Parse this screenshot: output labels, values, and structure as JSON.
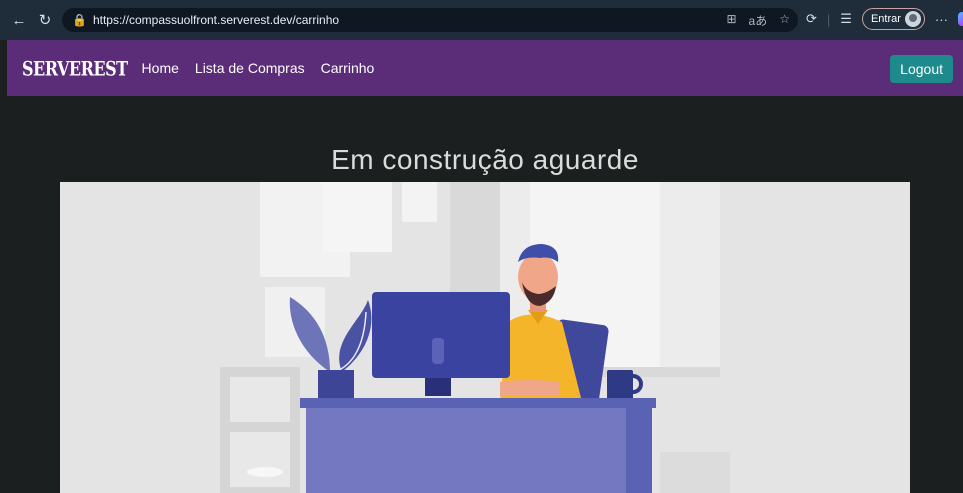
{
  "browser": {
    "url": "https://compassuolfront.serverest.dev/carrinho",
    "signin_label": "Entrar",
    "more_label": "···"
  },
  "navbar": {
    "brand": "SERVEREST",
    "links": [
      "Home",
      "Lista de Compras",
      "Carrinho"
    ],
    "logout_label": "Logout"
  },
  "main": {
    "title": "Em construção aguarde"
  },
  "colors": {
    "navbar": "#5b2c77",
    "logout": "#1f8a8c",
    "background": "#1c1f1f"
  }
}
